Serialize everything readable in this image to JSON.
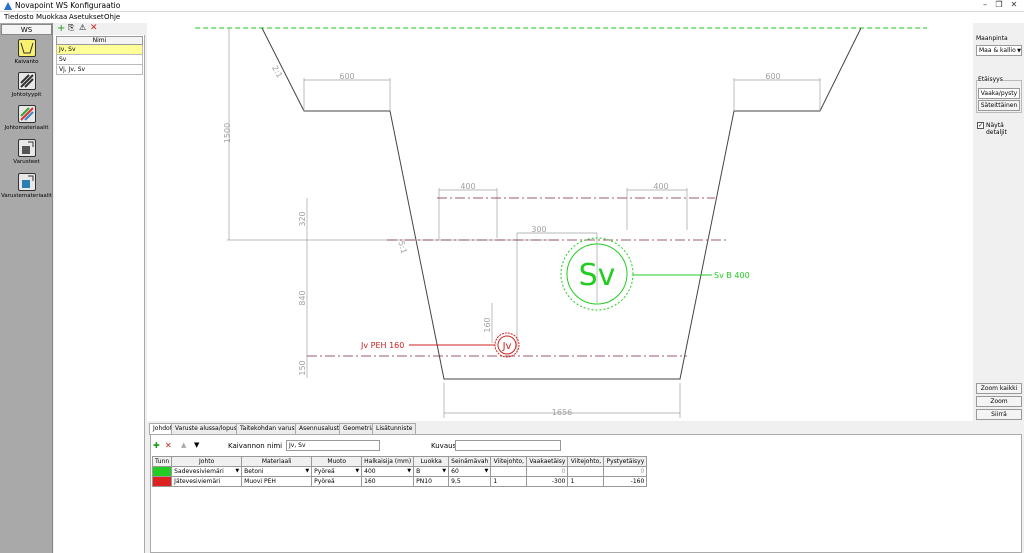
{
  "window": {
    "title": "Novapoint WS Konfiguraatio"
  },
  "menu": [
    "Tiedosto",
    "Muokkaa",
    "Asetukset",
    "Ohje"
  ],
  "ws": {
    "header": "WS",
    "items": [
      {
        "label": "Kaivanto",
        "icon": "excavation-icon"
      },
      {
        "label": "Johtotyypit",
        "icon": "pipe-types-icon"
      },
      {
        "label": "Johtomateriaalit",
        "icon": "pipe-materials-icon"
      },
      {
        "label": "Varusteet",
        "icon": "fittings-icon"
      },
      {
        "label": "Varustemateriaalit",
        "icon": "fitting-materials-icon"
      }
    ]
  },
  "list": {
    "header": "Nimi",
    "rows": [
      "Jv, Sv",
      "Sv",
      "Vj, Jv, Sv"
    ]
  },
  "drawing": {
    "dims": [
      "600",
      "600",
      "1500",
      "2:1",
      "400",
      "400",
      "300",
      "320",
      "840",
      "160",
      "150",
      "1656",
      "5:1"
    ],
    "labels": {
      "sv_big": "Sv",
      "sv_label": "Sv B 400",
      "jv_big": "Jv",
      "jv_label": "Jv PEH 160"
    },
    "colors": {
      "green": "#22cc22",
      "red": "#cc2222",
      "dim": "#a0a0a0"
    }
  },
  "right": {
    "maanpinta_label": "Maanpinta",
    "maanpinta_value": "Maa & kallio",
    "etaisyys_label": "Etäisyys",
    "btn_vaaka": "Vaaka/pysty",
    "btn_sate": "Säteittäinen",
    "nayta": "Näytä detaljit",
    "zoom_all": "Zoom kaikki",
    "zoom": "Zoom",
    "siirra": "Siirrä"
  },
  "tabs": [
    "Johdot",
    "Varuste alussa/lopussa",
    "Taitekohdan varuste",
    "Asennusalusta",
    "Geometria",
    "Lisätunniste"
  ],
  "form": {
    "name_label": "Kaivannon nimi",
    "name_value": "Jv, Sv",
    "desc_label": "Kuvaus",
    "desc_value": ""
  },
  "table": {
    "headers": [
      "Tunn",
      "Johto",
      "Materiaali",
      "Muoto",
      "Halkaisija (mm)",
      "Luokka",
      "Seinämävah",
      "Viitejohto,",
      "Vaakaetäisy",
      "Viitejohto,",
      "Pystyetäisyy"
    ],
    "rows": [
      {
        "color": "#22cc22",
        "johto": "Sadevesiviemäri",
        "mat": "Betoni",
        "muoto": "Pyöreä",
        "halk": "400",
        "luokka": "B",
        "seina": "60",
        "vj1": "",
        "vaaka": "0",
        "vj2": "",
        "pysty": "0"
      },
      {
        "color": "#dd2222",
        "johto": "Jätevesiviemäri",
        "mat": "Muovi PEH",
        "muoto": "Pyöreä",
        "halk": "160",
        "luokka": "PN10",
        "seina": "9,5",
        "vj1": "1",
        "vaaka": "-300",
        "vj2": "1",
        "pysty": "-160"
      }
    ]
  }
}
